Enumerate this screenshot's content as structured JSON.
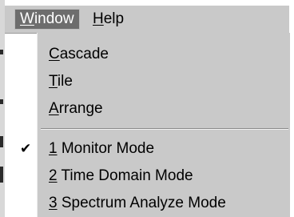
{
  "menubar": {
    "window": {
      "mnemonic": "W",
      "rest": "indow"
    },
    "help": {
      "mnemonic": "H",
      "rest": "elp"
    }
  },
  "window_menu": {
    "cascade": {
      "mnemonic": "C",
      "rest": "ascade"
    },
    "tile": {
      "mnemonic": "T",
      "rest": "ile"
    },
    "arrange": {
      "mnemonic": "A",
      "rest": "rrange"
    },
    "check_glyph": "✔",
    "monitor_mode": {
      "mnemonic": "1",
      "rest": " Monitor Mode",
      "checked": true
    },
    "time_domain_mode": {
      "mnemonic": "2",
      "rest": " Time Domain Mode",
      "checked": false
    },
    "spectrum_mode": {
      "mnemonic": "3",
      "rest": " Spectrum Analyze Mode",
      "checked": false
    }
  },
  "colors": {
    "menu_background": "#c9c9c9",
    "active_menu_background": "#6d6d6d",
    "active_menu_text": "#ffffff"
  }
}
